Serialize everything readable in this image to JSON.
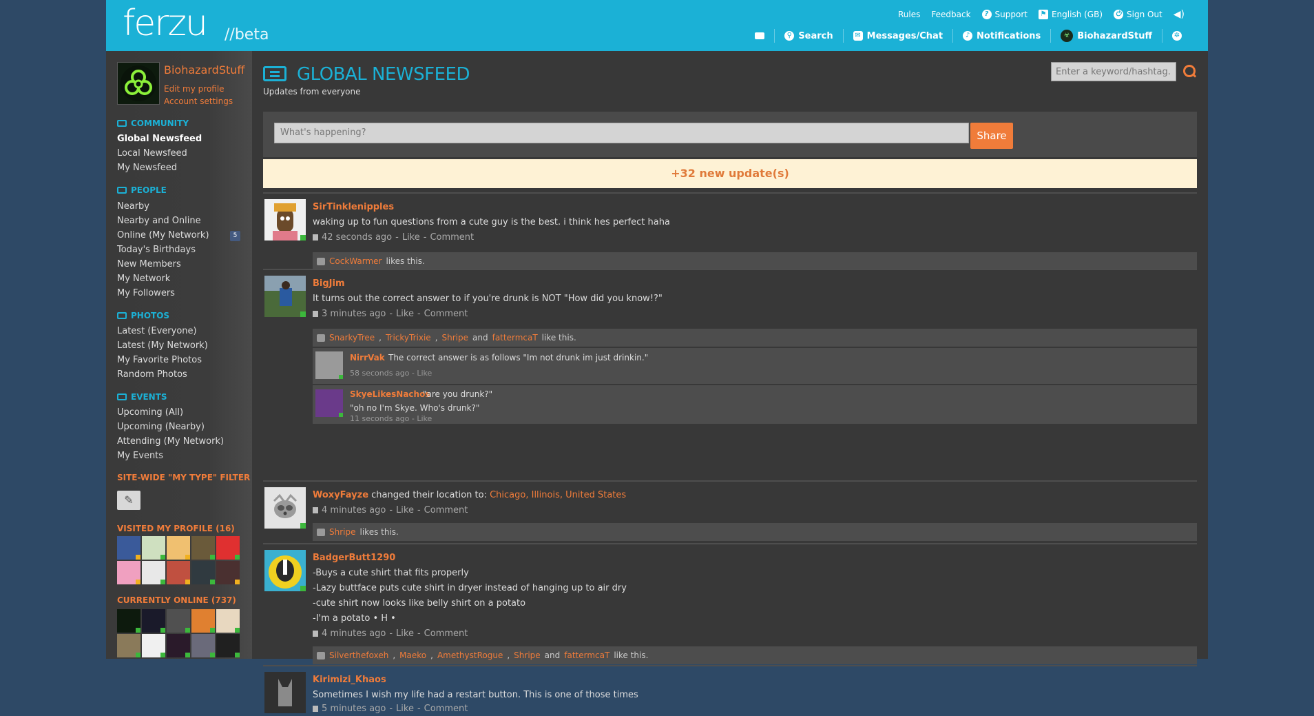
{
  "header": {
    "logo": "ferzu",
    "beta": "//beta",
    "toplinks": [
      "Rules",
      "Feedback",
      "Support",
      "English (GB)",
      "Sign Out"
    ],
    "nav": {
      "search": "Search",
      "messages": "Messages/Chat",
      "notifications": "Notifications",
      "user": "BiohazardStuff"
    }
  },
  "sidebar": {
    "username": "BiohazardStuff",
    "edit_profile": "Edit my profile",
    "account_settings": "Account settings",
    "community": {
      "title": "COMMUNITY",
      "items": [
        "Global Newsfeed",
        "Local Newsfeed",
        "My Newsfeed"
      ]
    },
    "people": {
      "title": "PEOPLE",
      "items": [
        "Nearby",
        "Nearby and Online",
        "Online (My Network)",
        "Today's Birthdays",
        "New Members",
        "My Network",
        "My Followers"
      ],
      "online_badge": "5"
    },
    "photos": {
      "title": "PHOTOS",
      "items": [
        "Latest (Everyone)",
        "Latest (My Network)",
        "My Favorite Photos",
        "Random Photos"
      ]
    },
    "events": {
      "title": "EVENTS",
      "items": [
        "Upcoming (All)",
        "Upcoming (Nearby)",
        "Attending (My Network)",
        "My Events"
      ]
    },
    "filter_title": "SITE-WIDE \"MY TYPE\" FILTER",
    "visited_title": "VISITED MY PROFILE (16)",
    "online_title": "CURRENTLY ONLINE (737)"
  },
  "main": {
    "title": "GLOBAL NEWSFEED",
    "subtitle": "Updates from everyone",
    "keyword_placeholder": "Enter a keyword/hashtag..",
    "compose_placeholder": "What's happening?",
    "share": "Share",
    "new_updates": "+32 new update(s)",
    "like_word": "Like",
    "comment_word": "Comment",
    "and_word": "and",
    "like_this": "like this.",
    "likes_this": "likes this.",
    "posts": [
      {
        "name": "SirTinklenipples",
        "text": "waking up to fun questions from a cute guy is the best. i think hes perfect haha",
        "time": "42 seconds ago",
        "likers": [
          "CockWarmer"
        ]
      },
      {
        "name": "BigJim",
        "text": "It turns out the correct answer to if you're drunk is NOT \"How did you know!?\"",
        "time": "3 minutes ago",
        "likers": [
          "SnarkyTree",
          "TrickyTrixie",
          "Shripe",
          "fattermcaT"
        ],
        "comments": [
          {
            "name": "NirrVak",
            "text": "The correct answer is as follows \"Im not drunk im just drinkin.\"",
            "time": "58 seconds ago"
          },
          {
            "name": "SkyeLikesNachos",
            "text": "\"are you drunk?\"",
            "text2": "\"oh no I'm Skye. Who's drunk?\"",
            "time": "11 seconds ago"
          }
        ]
      },
      {
        "name": "WoxyFayze",
        "action": "changed their location to:",
        "location": "Chicago, Illinois, United States",
        "time": "4 minutes ago",
        "likers": [
          "Shripe"
        ]
      },
      {
        "name": "BadgerButt1290",
        "lines": [
          "-Buys a cute shirt that fits properly",
          "-Lazy buttface puts cute shirt in dryer instead of hanging up to air dry",
          "-cute shirt now looks like belly shirt on a potato",
          "-I'm a potato • H •"
        ],
        "time": "4 minutes ago",
        "likers": [
          "Silverthefoxeh",
          "Maeko",
          "AmethystRogue",
          "Shripe",
          "fattermcaT"
        ]
      },
      {
        "name": "Kirimizi_Khaos",
        "text": "Sometimes I wish my life had a restart button. This is one of those times",
        "time": "5 minutes ago"
      }
    ]
  },
  "colors": {
    "accent": "#1bb1d6",
    "orange": "#f07c3a",
    "background": "#2e4966",
    "panel": "#383838"
  }
}
